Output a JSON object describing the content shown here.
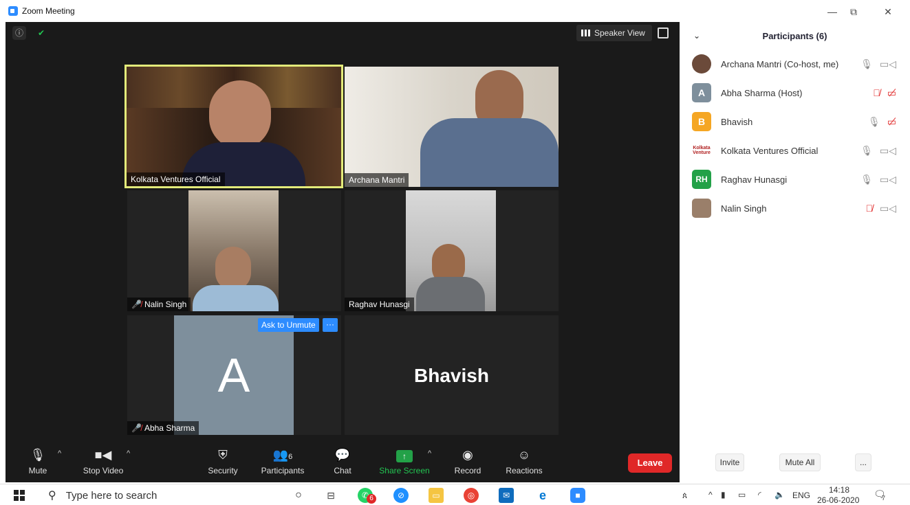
{
  "window": {
    "title": "Zoom Meeting",
    "minimize": "—",
    "restore": "⧉",
    "close": "✕"
  },
  "video": {
    "speaker_view_label": "Speaker View",
    "info_icon": "ⓘ",
    "shield_icon": "✔",
    "tiles": [
      {
        "name": "Kolkata Ventures Official",
        "muted": false
      },
      {
        "name": "Archana Mantri",
        "muted": false
      },
      {
        "name": "Nalin Singh",
        "muted": true
      },
      {
        "name": "Raghav Hunasgi",
        "muted": false
      },
      {
        "name": "Abha Sharma",
        "muted": true,
        "avatar_letter": "A",
        "ask_to_unmute": "Ask to Unmute",
        "more": "···"
      },
      {
        "name": "Bhavish",
        "big_name": "Bhavish"
      }
    ]
  },
  "toolbar": {
    "mute": "Mute",
    "stop_video": "Stop Video",
    "security": "Security",
    "participants": "Participants",
    "participants_count": "6",
    "chat": "Chat",
    "share_screen": "Share Screen",
    "record": "Record",
    "reactions": "Reactions",
    "leave": "Leave"
  },
  "panel": {
    "title": "Participants (6)",
    "participants": [
      {
        "name": "Archana Mantri (Co-host, me)",
        "avatar": "",
        "color": "#6b4a3a",
        "mic": "on",
        "cam": "on"
      },
      {
        "name": "Abha Sharma (Host)",
        "avatar": "A",
        "color": "#7e8f9c",
        "mic": "muted",
        "cam": "off"
      },
      {
        "name": "Bhavish",
        "avatar": "B",
        "color": "#F5A623",
        "mic": "on",
        "cam": "off"
      },
      {
        "name": "Kolkata Ventures Official",
        "avatar": "Kolkata Venture",
        "color": "#ffffff",
        "mic": "on",
        "cam": "on"
      },
      {
        "name": "Raghav Hunasgi",
        "avatar": "RH",
        "color": "#23A148",
        "mic": "on",
        "cam": "on"
      },
      {
        "name": "Nalin Singh",
        "avatar": "",
        "color": "#9a7f6a",
        "mic": "muted",
        "cam": "on"
      }
    ],
    "invite": "Invite",
    "mute_all": "Mute All",
    "more": "..."
  },
  "taskbar": {
    "search_placeholder": "Type here to search",
    "language": "ENG",
    "time": "14:18",
    "date": "26-06-2020",
    "notification_badge": "7",
    "whatsapp_badge": "6"
  },
  "colors": {
    "zoom_blue": "#2D8CFF",
    "leave_red": "#E02828",
    "share_green": "#23A148",
    "active_speaker": "#E3EB7A"
  }
}
